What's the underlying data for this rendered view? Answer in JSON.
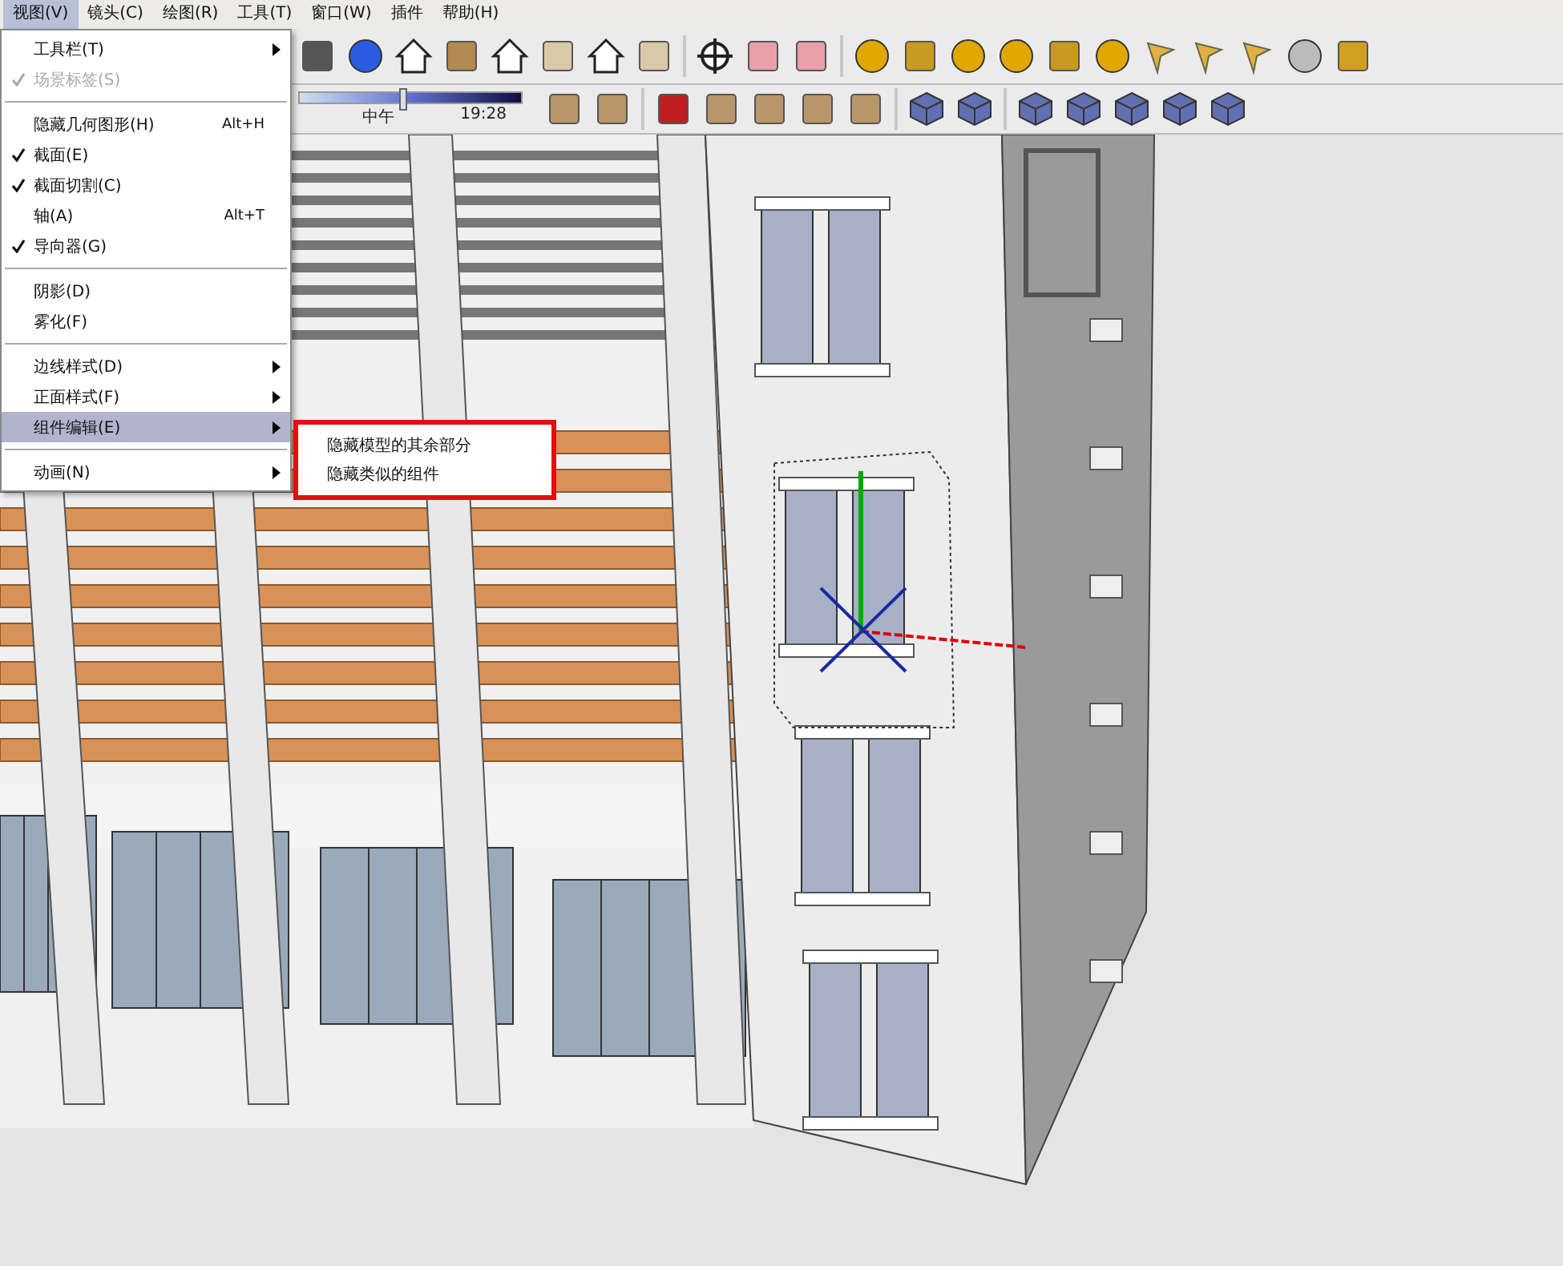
{
  "menu_bar": [
    {
      "label": "视图(V)",
      "selected": true
    },
    {
      "label": "镜头(C)",
      "selected": false
    },
    {
      "label": "绘图(R)",
      "selected": false
    },
    {
      "label": "工具(T)",
      "selected": false
    },
    {
      "label": "窗口(W)",
      "selected": false
    },
    {
      "label": "插件",
      "selected": false
    },
    {
      "label": "帮助(H)",
      "selected": false
    }
  ],
  "menu": {
    "items": [
      {
        "kind": "item",
        "label": "工具栏(T)",
        "checked": false,
        "disabled": false,
        "submenu": true,
        "selected": false
      },
      {
        "kind": "item",
        "label": "场景标签(S)",
        "checked": true,
        "disabled": true,
        "submenu": false,
        "selected": false
      },
      {
        "kind": "separator"
      },
      {
        "kind": "item",
        "label": "隐藏几何图形(H)",
        "shortcut": "Alt+H",
        "checked": false,
        "disabled": false,
        "submenu": false,
        "selected": false
      },
      {
        "kind": "item",
        "label": "截面(E)",
        "checked": true,
        "disabled": false,
        "submenu": false,
        "selected": false
      },
      {
        "kind": "item",
        "label": "截面切割(C)",
        "checked": true,
        "disabled": false,
        "submenu": false,
        "selected": false
      },
      {
        "kind": "item",
        "label": "轴(A)",
        "shortcut": "Alt+T",
        "checked": false,
        "disabled": false,
        "submenu": false,
        "selected": false
      },
      {
        "kind": "item",
        "label": "导向器(G)",
        "checked": true,
        "disabled": false,
        "submenu": false,
        "selected": false
      },
      {
        "kind": "separator"
      },
      {
        "kind": "item",
        "label": "阴影(D)",
        "checked": false,
        "disabled": false,
        "submenu": false,
        "selected": false
      },
      {
        "kind": "item",
        "label": "雾化(F)",
        "checked": false,
        "disabled": false,
        "submenu": false,
        "selected": false
      },
      {
        "kind": "separator"
      },
      {
        "kind": "item",
        "label": "边线样式(D)",
        "checked": false,
        "disabled": false,
        "submenu": true,
        "selected": false
      },
      {
        "kind": "item",
        "label": "正面样式(F)",
        "checked": false,
        "disabled": false,
        "submenu": true,
        "selected": false
      },
      {
        "kind": "item",
        "label": "组件编辑(E)",
        "checked": false,
        "disabled": false,
        "submenu": true,
        "selected": true
      },
      {
        "kind": "separator"
      },
      {
        "kind": "item",
        "label": "动画(N)",
        "checked": false,
        "disabled": false,
        "submenu": true,
        "selected": false
      }
    ]
  },
  "submenu": {
    "highlighted": true,
    "items": [
      {
        "label": "隐藏模型的其余部分"
      },
      {
        "label": "隐藏类似的组件"
      }
    ]
  },
  "shadow_slider": {
    "level": 0.45,
    "labels": [
      "中午",
      "19:28"
    ]
  }
}
